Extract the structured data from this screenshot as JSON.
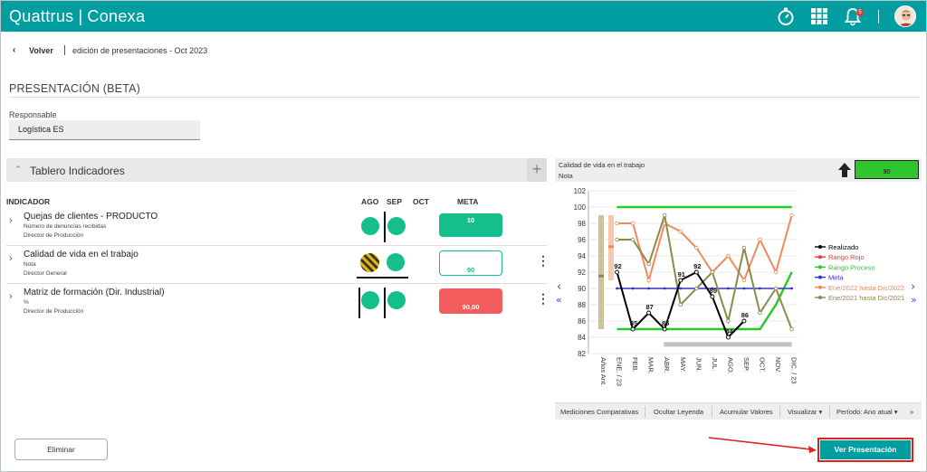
{
  "app": {
    "brand_left": "Quattrus",
    "brand_sep": "|",
    "brand_right": "Conexa",
    "notifications": "5"
  },
  "breadcrumb": {
    "back": "Volver",
    "path": "edición de presentaciones - Oct 2023"
  },
  "page": {
    "title": "PRESENTACIÓN (BETA)",
    "responsable_label": "Responsable",
    "responsable_value": "Logística ES"
  },
  "tablero": {
    "title": "Tablero Indicadores",
    "headers": {
      "indicador": "INDICADOR",
      "ago": "AGO",
      "sep": "SEP",
      "oct": "OCT",
      "meta": "META"
    },
    "rows": [
      {
        "name": "Quejas de clientes - PRODUCTO",
        "desc": "Número de denuncias recibidas",
        "owner": "Director de Producción",
        "meta": "10"
      },
      {
        "name": "Calidad de vida en el trabajo",
        "desc": "Nota",
        "owner": "Director General",
        "meta": "90"
      },
      {
        "name": "Matriz de formación (Dir. Industrial)",
        "desc": "%",
        "owner": "Director de Producción",
        "meta": "90,00"
      }
    ]
  },
  "chart_panel": {
    "title": "Calidad de vida en el trabajo",
    "subtitle": "Nota",
    "meta_value": "90",
    "footer": {
      "mediciones": "Mediciones Comparativas",
      "leyenda": "Ocultar Leyenda",
      "acumular": "Acumular Valores",
      "visualizar": "Visualizar ▾",
      "periodo": "Período: Ano atual ▾",
      "more": "»"
    }
  },
  "buttons": {
    "eliminar": "Eliminar",
    "ver": "Ver Presentación"
  },
  "colors": {
    "brand": "#009ea1",
    "status_green": "#15bf8c",
    "meta_red": "#f25c5c",
    "realizado": "#000000",
    "rango_rojo": "#e53935",
    "rango_proceso": "#22cc22",
    "meta_line": "#3333cc",
    "ene2022": "#f08a5d",
    "ene2021": "#8a8a4a"
  },
  "chart_data": {
    "type": "line",
    "categories": [
      "Años Ant.",
      "ENE. / 23",
      "FEB.",
      "MAR.",
      "ABR.",
      "MAY.",
      "JUN.",
      "JUL.",
      "AGO.",
      "SEP.",
      "OCT.",
      "NOV.",
      "DIC. / 23"
    ],
    "ylim": [
      82,
      102
    ],
    "yticks": [
      82,
      84,
      86,
      88,
      90,
      92,
      94,
      96,
      98,
      100,
      102
    ],
    "legend_position": "right",
    "series": [
      {
        "name": "Realizado",
        "x": [
          "ENE. / 23",
          "FEB.",
          "MAR.",
          "ABR.",
          "MAY.",
          "JUN.",
          "JUL.",
          "AGO.",
          "SEP."
        ],
        "values": [
          92,
          85,
          87,
          85,
          91,
          92,
          89,
          84,
          86
        ],
        "labels": [
          "92",
          "85",
          "87",
          "85",
          "91",
          "92",
          "89",
          "84",
          "86"
        ]
      },
      {
        "name": "Rango Rojo",
        "values": []
      },
      {
        "name": "Rango Proceso",
        "x": [
          "ENE. / 23",
          "FEB.",
          "MAR.",
          "ABR.",
          "MAY.",
          "JUN.",
          "JUL.",
          "AGO.",
          "SEP.",
          "OCT.",
          "NOV.",
          "DIC. / 23"
        ],
        "values": [
          85,
          85,
          85,
          85,
          85,
          85,
          85,
          85,
          85,
          85,
          88,
          92
        ]
      },
      {
        "name": "Meta",
        "x": [
          "ENE. / 23",
          "FEB.",
          "MAR.",
          "ABR.",
          "MAY.",
          "JUN.",
          "JUL.",
          "AGO.",
          "SEP.",
          "OCT.",
          "NOV.",
          "DIC. / 23"
        ],
        "values": [
          90,
          90,
          90,
          90,
          90,
          90,
          90,
          90,
          90,
          90,
          90,
          90
        ]
      },
      {
        "name": "Ene/2022 hasta Dic/2022",
        "x": [
          "ENE. / 23",
          "FEB.",
          "MAR.",
          "ABR.",
          "MAY.",
          "JUN.",
          "JUL.",
          "AGO.",
          "SEP.",
          "OCT.",
          "NOV.",
          "DIC. / 23"
        ],
        "values": [
          98,
          98,
          91,
          98,
          97,
          95,
          92,
          94,
          91,
          96,
          92,
          99
        ]
      },
      {
        "name": "Ene/2021 hasta Dic/2021",
        "x": [
          "ENE. / 23",
          "FEB.",
          "MAR.",
          "ABR.",
          "MAY.",
          "JUN.",
          "JUL.",
          "AGO.",
          "SEP.",
          "OCT.",
          "NOV.",
          "DIC. / 23"
        ],
        "values": [
          96,
          96,
          93,
          99,
          88,
          90,
          92,
          86,
          95,
          87,
          90,
          85
        ]
      }
    ],
    "upper_green_line": 100
  }
}
